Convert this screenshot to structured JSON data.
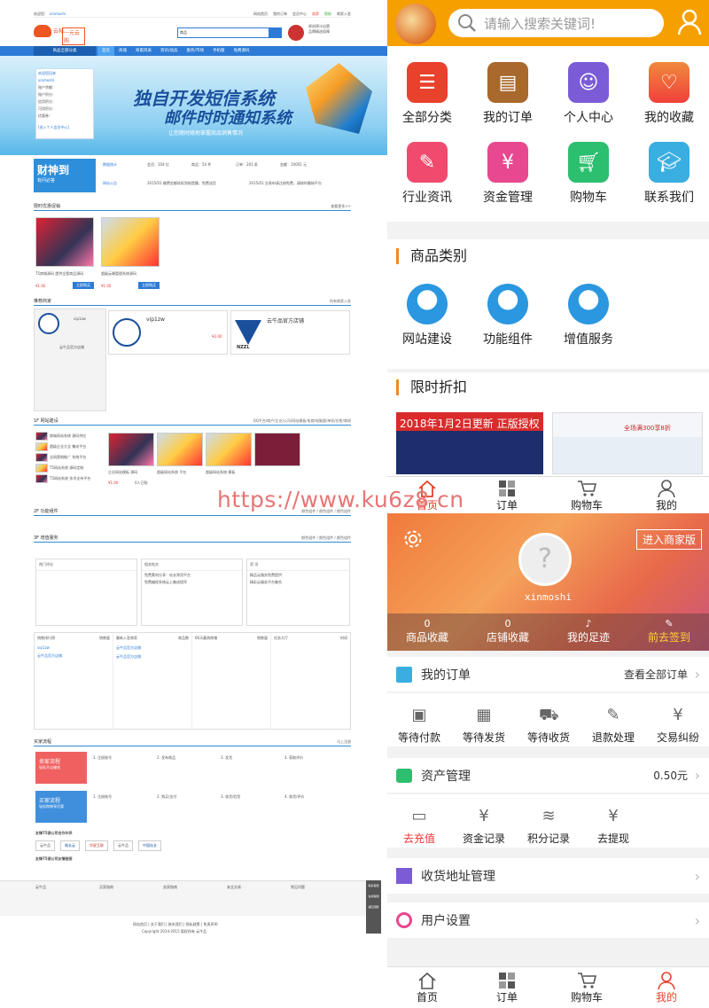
{
  "left": {
    "topbar": {
      "welcome": "欢迎您：",
      "user": "xinmoshi",
      "links": [
        "网站首页",
        "我的订单",
        "会员中心",
        "卖家",
        "帮助",
        "商家入驻"
      ]
    },
    "logo_text": "云帖",
    "brand_text": "一元云购",
    "search_placeholder": "商品",
    "promo_text": [
      "原创原汁自营",
      "品牌精选保障"
    ],
    "nav": {
      "category": "商品全部分类",
      "items": [
        "首页",
        "商城",
        "商家风采",
        "资讯/动态",
        "服务/市场",
        "手机版",
        "免费源码"
      ]
    },
    "user_panel": {
      "title": "欢迎您回来",
      "name": "xinmoshi",
      "lines": [
        "账户余额：",
        "账户积分：",
        "信用积分：",
        "可用积分：",
        "优惠券："
      ],
      "link": "[进入个人会员中心]"
    },
    "banner": {
      "line1": "独自开发短信系统",
      "line2": "邮件时时通知系统",
      "line3": "让您随时随地掌握商品销售情况"
    },
    "stats": {
      "logo": "财神到",
      "logo_sub": "有问必答",
      "labels": [
        "数据统计",
        "网站公告"
      ],
      "values": [
        "会员：104 位",
        "商品：54 件",
        "订单：201 条",
        "金额：10001 元"
      ],
      "notices": [
        "2015/01 缴费金额较低到账提醒，免费送货",
        "2015/01 交易申请注册免费，请按时缴纳平台"
      ]
    },
    "sec1": {
      "title": "限时优惠促销",
      "more": "查看更多>>",
      "items": [
        {
          "name": "T5商城源码 提供全套商品源码",
          "price": "¥1.00",
          "btn": "立即购买"
        },
        {
          "name": "超级云端管理系统源码",
          "price": "¥1.00",
          "btn": "立即购买"
        }
      ]
    },
    "sec2": {
      "title": "推荐商家",
      "more": "所有商家入驻",
      "shops": [
        {
          "name": "vip1zw",
          "detail": "云牛品官方店铺"
        },
        {
          "name": "vip1zw",
          "price": "¥2.00"
        },
        {
          "name": "云牛品官方店铺",
          "tag": "NZZL"
        }
      ]
    },
    "sec3": {
      "title": "1F 网站建设",
      "more": "QQ平台/商户/企业/公司/网站模板/电商/电脑版/单机/仿鱼/商网",
      "items": [
        "商城网站系统 源码供应",
        "超级企业大全 集成平台",
        "全网营销推广 系统平台",
        "T5网站系统 源码定制",
        "T5网站系统 技术支持平台",
        "企业网站模板 源码",
        "超级网站系统 平台",
        "超级网站系统 模板"
      ],
      "price": "¥1.00",
      "count": "0人已购"
    },
    "sec4": {
      "title": "2F 功能组件",
      "more": "颜色组件 / 颜色组件 / 颜色组件"
    },
    "sec5": {
      "title": "3F 增值服务",
      "more": "颜色组件 / 颜色组件 / 颜色组件",
      "cols": [
        {
          "title": "热门评论"
        },
        {
          "title": "相关帖文",
          "items": [
            "免费素材分享：站长常用平台",
            "免费编程系统云上集成程序"
          ]
        },
        {
          "title": "资 讯",
          "items": [
            "精品云服务免费提供",
            "精彩云服务平台集合"
          ]
        }
      ]
    },
    "rank": {
      "cols": [
        {
          "title": "销售排行榜",
          "label": "销售量",
          "rows": [
            "vip1zw",
            "云牛品官方店铺"
          ]
        },
        {
          "title": "最新入驻商家",
          "label": "商品数",
          "rows": [
            "云牛品官方店铺",
            "云牛品官方店铺"
          ]
        },
        {
          "title": "66天最热商铺",
          "label": "销售量"
        },
        {
          "title": "任务大厅",
          "label": "时间"
        }
      ]
    },
    "flow": {
      "title": "买家流程",
      "more": "马上注册",
      "buyer": {
        "title": "卖家流程",
        "sub": "轻松开店赚钱"
      },
      "steps1": [
        "1. 注册账号",
        "2. 发布商品",
        "3. 发货",
        "4. 获取评价"
      ],
      "steps2": [
        "1. 注册账号",
        "2. 购买/支付",
        "3. 收货/验货",
        "4. 收货/评价"
      ],
      "buyer2": {
        "title": "买家流程",
        "sub": "轻松购物享优惠"
      }
    },
    "partners": {
      "title": "友情T5源公司合作伙伴",
      "title2": "友情T5源公司友情链接",
      "logos": [
        "云牛品",
        "城长云",
        "华星互联",
        "云牛品",
        "中国站长"
      ]
    },
    "footer": {
      "cols": [
        "云牛品",
        "买家指南",
        "卖家指南",
        "安全交易",
        "常见问题"
      ],
      "copyright": "Copyright 2014-2015 版权所有 云牛品",
      "links": "网站首页 | 关于我们 | 联系我们 | 隐私政策 | 免责声明",
      "float": [
        "联系客服",
        "在线客服",
        "返回顶部"
      ]
    }
  },
  "watermark": "https://www.ku6z8.cn",
  "mobile_home": {
    "search_placeholder": "请输入搜索关键词!",
    "grid": [
      {
        "label": "全部分类",
        "icon": "list-icon",
        "color": "#e8412c"
      },
      {
        "label": "我的订单",
        "icon": "clipboard-icon",
        "color": "#a9682c"
      },
      {
        "label": "个人中心",
        "icon": "user-icon",
        "color": "#7b5cd6"
      },
      {
        "label": "我的收藏",
        "icon": "heart-icon",
        "color": "#f05a3c"
      },
      {
        "label": "行业资讯",
        "icon": "pencil-icon",
        "color": "#f04b6e"
      },
      {
        "label": "资金管理",
        "icon": "yen-icon",
        "color": "#e8488f"
      },
      {
        "label": "购物车",
        "icon": "cart-icon",
        "color": "#2bbf6f"
      },
      {
        "label": "联系我们",
        "icon": "graduation-cap-icon",
        "color": "#3aaee0"
      }
    ],
    "category_title": "商品类别",
    "categories": [
      "网站建设",
      "功能组件",
      "增值服务"
    ],
    "flash_title": "限时折扣",
    "flash_banner1": "2018年1月2日更新 正版授权",
    "flash_banner2": "全场满300享8折",
    "tabbar": [
      "首页",
      "订单",
      "购物车",
      "我的"
    ]
  },
  "mobile_profile": {
    "merchant_button": "进入商家版",
    "username": "xinmoshi",
    "stats": [
      {
        "value": "0",
        "label": "商品收藏"
      },
      {
        "value": "0",
        "label": "店铺收藏"
      },
      {
        "value": "",
        "label": "我的足迹"
      },
      {
        "value": "",
        "label": "前去签到"
      }
    ],
    "orders": {
      "title": "我的订单",
      "link": "查看全部订单",
      "items": [
        "等待付款",
        "等待发货",
        "等待收货",
        "退款处理",
        "交易纠纷"
      ]
    },
    "assets": {
      "title": "资产管理",
      "value": "0.50元",
      "items": [
        "去充值",
        "资金记录",
        "积分记录",
        "去提现"
      ]
    },
    "address": "收货地址管理",
    "settings": "用户设置",
    "tabbar": [
      "首页",
      "订单",
      "购物车",
      "我的"
    ]
  }
}
